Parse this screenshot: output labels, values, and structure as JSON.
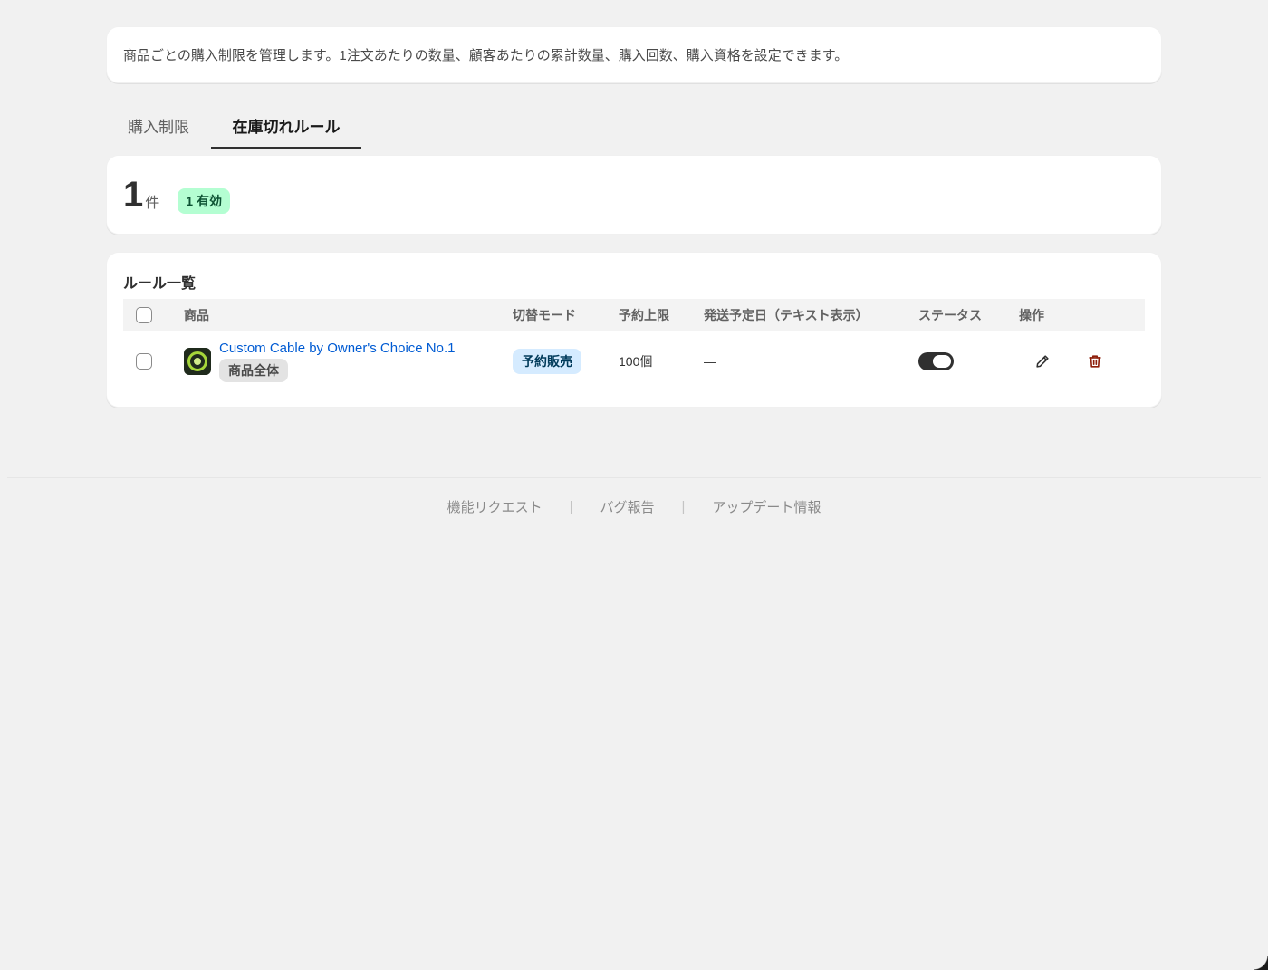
{
  "intro": {
    "text": "商品ごとの購入制限を管理します。1注文あたりの数量、顧客あたりの累計数量、購入回数、購入資格を設定できます。"
  },
  "tabs": [
    {
      "label": "購入制限",
      "active": false
    },
    {
      "label": "在庫切れルール",
      "active": true
    }
  ],
  "summary": {
    "count": "1",
    "unit": "件",
    "active_badge": "1 有効"
  },
  "rules": {
    "title": "ルール一覧",
    "columns": {
      "product": "商品",
      "mode": "切替モード",
      "limit": "予約上限",
      "ship_date": "発送予定日（テキスト表示）",
      "status": "ステータス",
      "actions": "操作"
    },
    "rows": [
      {
        "product_name": "Custom Cable by Owner's Choice No.1",
        "scope": "商品全体",
        "mode": "予約販売",
        "limit": "100個",
        "ship_date": "—",
        "status_enabled": true
      }
    ]
  },
  "footer": {
    "links": [
      "機能リクエスト",
      "バグ報告",
      "アップデート情報"
    ],
    "separator": "|"
  },
  "colors": {
    "link": "#005bd3",
    "active_badge_bg": "#b4fed2",
    "mode_badge_bg": "#d5ebff",
    "delete_icon": "#8e1f0b",
    "page_bg": "#f1f1f1"
  },
  "icons": {
    "edit": "pencil-icon",
    "delete": "trash-icon"
  }
}
